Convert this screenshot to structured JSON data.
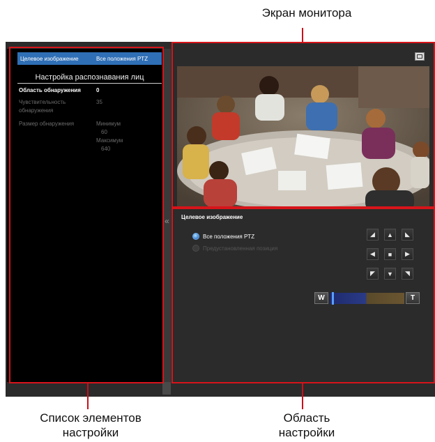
{
  "callouts": {
    "monitor_screen": "Экран монитора",
    "settings_list": [
      "Список элементов",
      "настройки"
    ],
    "settings_area": [
      "Область",
      "настройки"
    ]
  },
  "left_panel": {
    "target_label": "Целевое изображение",
    "target_value": "Все положения PTZ",
    "section_title": "Настройка распознавания лиц",
    "params": [
      {
        "label": "Область обнаружения",
        "value": "0",
        "enabled": true
      },
      {
        "label": [
          "Чувствительность",
          "обнаружения"
        ],
        "value": "35",
        "enabled": false
      },
      {
        "label": "Размер обнаружения",
        "value": [
          "Минимум",
          "60",
          "Максимум",
          "640"
        ],
        "enabled": false
      }
    ]
  },
  "right_panel": {
    "section_title": "Целевое изображение",
    "options": [
      {
        "label": "Все положения PTZ",
        "selected": true
      },
      {
        "label": "Предустановленная позиция",
        "selected": false
      }
    ],
    "zoom": {
      "wide_label": "W",
      "tele_label": "T"
    },
    "collapse_glyph": "«"
  },
  "colors": {
    "accent_red": "#d7141a",
    "selection_blue": "#2f6fb6",
    "panel_bg": "#2b2b2b"
  },
  "icons": [
    "expand-view-icon",
    "arrow-up-left-icon",
    "arrow-up-icon",
    "arrow-up-right-icon",
    "arrow-left-icon",
    "home-icon",
    "arrow-right-icon",
    "arrow-down-left-icon",
    "arrow-down-icon",
    "arrow-down-right-icon"
  ]
}
